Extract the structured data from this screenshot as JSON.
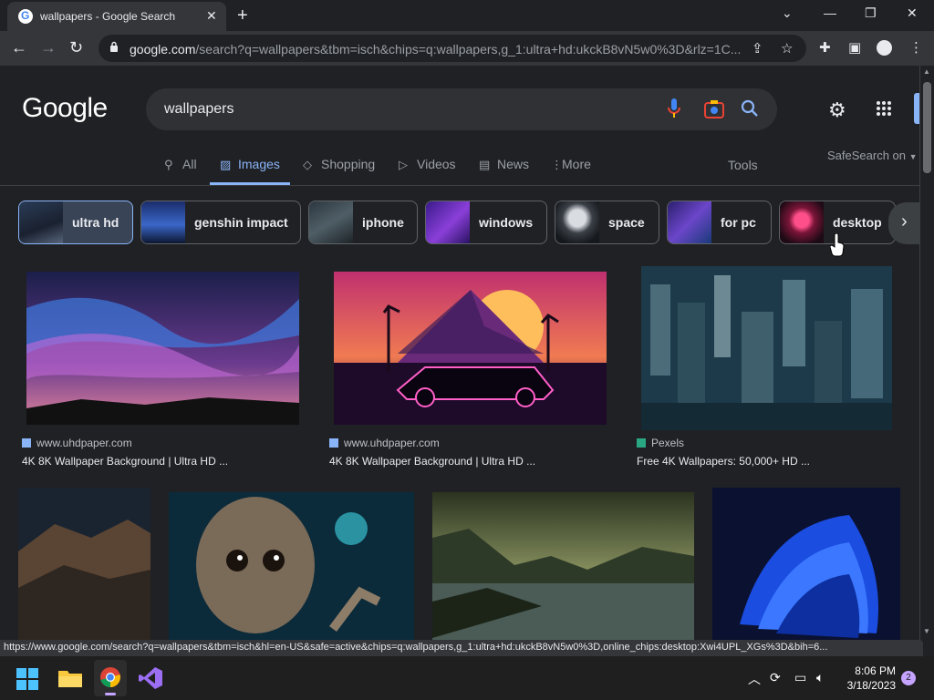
{
  "browser": {
    "tab_title": "wallpapers - Google Search",
    "favicon_letter": "G",
    "url_host": "google.com",
    "url_path": "/search?q=wallpapers&tbm=isch&chips=q:wallpapers,g_1:ultra+hd:ukckB8vN5w0%3D&rlz=1C...",
    "status_url": "https://www.google.com/search?q=wallpapers&tbm=isch&hl=en-US&safe=active&chips=q:wallpapers,g_1:ultra+hd:ukckB8vN5w0%3D,online_chips:desktop:Xwi4UPL_XGs%3D&bih=6..."
  },
  "google": {
    "logo": "Google",
    "query": "wallpapers",
    "tabs": [
      {
        "label": "All",
        "icon": "search-icon"
      },
      {
        "label": "Images",
        "icon": "image-icon",
        "active": true
      },
      {
        "label": "Shopping",
        "icon": "tag-icon"
      },
      {
        "label": "Videos",
        "icon": "play-icon"
      },
      {
        "label": "News",
        "icon": "news-icon"
      },
      {
        "label": "More",
        "icon": "more-icon"
      }
    ],
    "tools": "Tools",
    "safesearch": "SafeSearch on",
    "chips": [
      {
        "label": "ultra hd",
        "selected": true
      },
      {
        "label": "genshin impact"
      },
      {
        "label": "iphone"
      },
      {
        "label": "windows"
      },
      {
        "label": "space"
      },
      {
        "label": "for pc"
      },
      {
        "label": "desktop"
      }
    ],
    "results": [
      {
        "source": "www.uhdpaper.com",
        "title": "4K 8K Wallpaper Background | Ultra HD ..."
      },
      {
        "source": "www.uhdpaper.com",
        "title": "4K 8K Wallpaper Background | Ultra HD ..."
      },
      {
        "source": "Pexels",
        "title": "Free 4K Wallpapers: 50,000+ HD ..."
      }
    ]
  },
  "taskbar": {
    "time": "8:06 PM",
    "date": "3/18/2023",
    "notifications": "2"
  },
  "colors": {
    "page_bg": "#202124",
    "accent": "#8ab4f8",
    "chip_selected_bg": "#394457"
  }
}
